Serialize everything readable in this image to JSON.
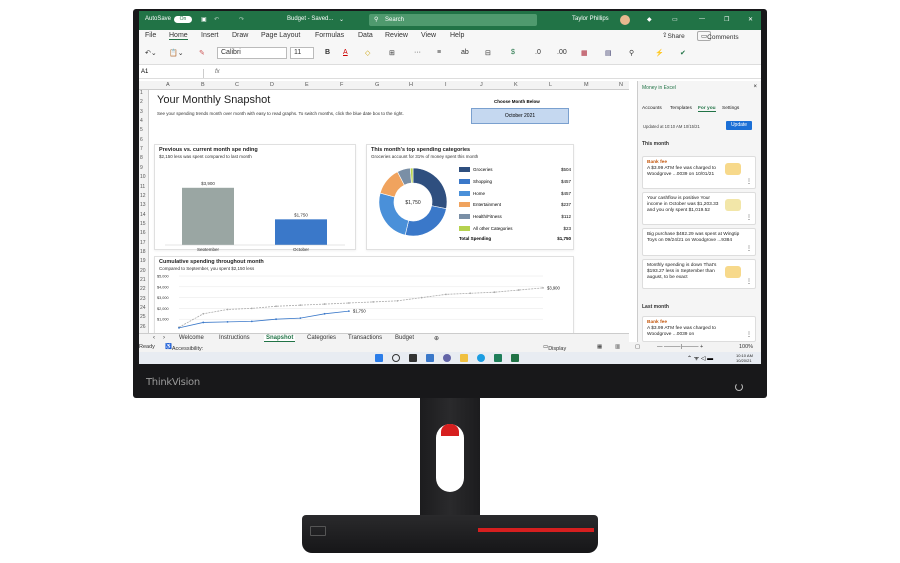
{
  "monitor": {
    "brand": "ThinkVision"
  },
  "titlebar": {
    "autosave": "AutoSave",
    "autosave_state": "On",
    "doc_title": "Budget - Saved...",
    "search_placeholder": "Search",
    "user": "Taylor Phillips"
  },
  "menu": {
    "items": [
      "File",
      "Home",
      "Insert",
      "Draw",
      "Page Layout",
      "Formulas",
      "Data",
      "Review",
      "View",
      "Help"
    ],
    "active": "Home",
    "share": "Share",
    "comments": "Comments"
  },
  "ribbon": {
    "font": "Calibri",
    "size": "11",
    "bold": "B"
  },
  "formula": {
    "namebox": "A1",
    "fx": "fx"
  },
  "columns": [
    "A",
    "B",
    "C",
    "D",
    "E",
    "F",
    "G",
    "H",
    "I",
    "J",
    "K",
    "L",
    "M",
    "N"
  ],
  "rows": [
    "1",
    "2",
    "3",
    "4",
    "5",
    "6",
    "7",
    "8",
    "9",
    "10",
    "11",
    "12",
    "13",
    "14",
    "15",
    "16",
    "17",
    "18",
    "19",
    "20",
    "21",
    "22",
    "23",
    "24",
    "25",
    "26"
  ],
  "sheet": {
    "title": "Your Monthly Snapshot",
    "subtitle": "See your spending trends month over month with easy to read graphs. To switch months, click the blue date box to the right.",
    "choose_label": "Choose Month Below",
    "month": "October 2021"
  },
  "cards": {
    "prev": {
      "title": "Previous vs. current month spe nding",
      "sub": "$2,150 less was spent compared to last month"
    },
    "top": {
      "title": "This month's top spending categories",
      "sub": "Groceries account for 31% of money spent this month",
      "center": "$1,750",
      "total_label": "Total Spending",
      "total_value": "$1,750"
    },
    "cumulative": {
      "title": "Cumulative spending throughout month",
      "sub": "Compared to September, you spent $2,150 less",
      "end_prev": "$3,900",
      "end_cur": "$1,750"
    }
  },
  "chart_data": [
    {
      "type": "bar",
      "categories": [
        "September",
        "October"
      ],
      "values": [
        3900,
        1750
      ],
      "labels": [
        "$3,900",
        "$1,750"
      ],
      "colors": [
        "#9aa6a3",
        "#3a78c9"
      ],
      "ylim": [
        0,
        4500
      ]
    },
    {
      "type": "pie",
      "categories": [
        "Groceries",
        "Shopping",
        "Home",
        "Entertainment",
        "Health/Fitness",
        "All other Categories"
      ],
      "values": [
        504,
        457,
        457,
        237,
        112,
        23
      ],
      "labels": [
        "$504",
        "$457",
        "$457",
        "$237",
        "$112",
        "$23"
      ],
      "colors": [
        "#2f4f7f",
        "#3a78c9",
        "#4a90d9",
        "#f0a35e",
        "#7a8fa6",
        "#b6d24f"
      ]
    },
    {
      "type": "line",
      "x": [
        1,
        3,
        5,
        7,
        9,
        11,
        13,
        15,
        17,
        19,
        21,
        23,
        25,
        27,
        29,
        31
      ],
      "ylim": [
        0,
        5000
      ],
      "yticks": [
        "$5,000",
        "$4,000",
        "$3,000",
        "$2,000",
        "$1,000"
      ],
      "xticks": [
        "1",
        "3",
        "5",
        "7",
        "9",
        "11",
        "13",
        "15",
        "17",
        "19",
        "21",
        "23",
        "25",
        "27",
        "29",
        "31"
      ],
      "series": [
        {
          "values": [
            250,
            1500,
            1900,
            2000,
            2200,
            2300,
            2400,
            2500,
            2600,
            2700,
            3000,
            3300,
            3400,
            3500,
            3700,
            3900
          ],
          "color": "#aaaaaa"
        },
        {
          "values": [
            200,
            700,
            750,
            800,
            1000,
            1100,
            1500,
            1750
          ],
          "color": "#3a78c9"
        }
      ]
    }
  ],
  "tabs": {
    "items": [
      "Welcome",
      "Instructions",
      "Snapshot",
      "Categories",
      "Transactions",
      "Budget"
    ],
    "active": "Snapshot"
  },
  "status": {
    "ready": "Ready",
    "accessibility": "Accessibility: Good to go",
    "display": "Display Settings",
    "zoom": "100%"
  },
  "pane": {
    "title": "Money in Excel",
    "tabs": [
      "Accounts",
      "Templates",
      "For you",
      "Settings"
    ],
    "active_tab": "For you",
    "updated": "Updated at 10:10 AM 10/15/21",
    "update_button": "Update",
    "section_this_month": "This month",
    "section_last_month": "Last month",
    "cards": [
      {
        "kicker": "Bank fee",
        "text": "A $3.99 ATM fee was charged to Woodgrove ...0039 on 10/01/21"
      },
      {
        "kicker": "",
        "text": "Your cashflow is positive Your income in October was $1,203.33 and you only spent $1,019.52"
      },
      {
        "kicker": "",
        "text": "Big purchase $482.29 was spent at Wingtip Toys on 09/24/21 on Woodgrove ...9384"
      },
      {
        "kicker": "",
        "text": "Monthly spending is down That's $193.27 less in September than august, to be exact"
      },
      {
        "kicker": "Bank fee",
        "text": "A $3.99 ATM fee was charged to Woodgrove ...0039 on"
      }
    ]
  },
  "taskbar": {
    "time": "10:10 AM",
    "date": "10/20/21"
  }
}
